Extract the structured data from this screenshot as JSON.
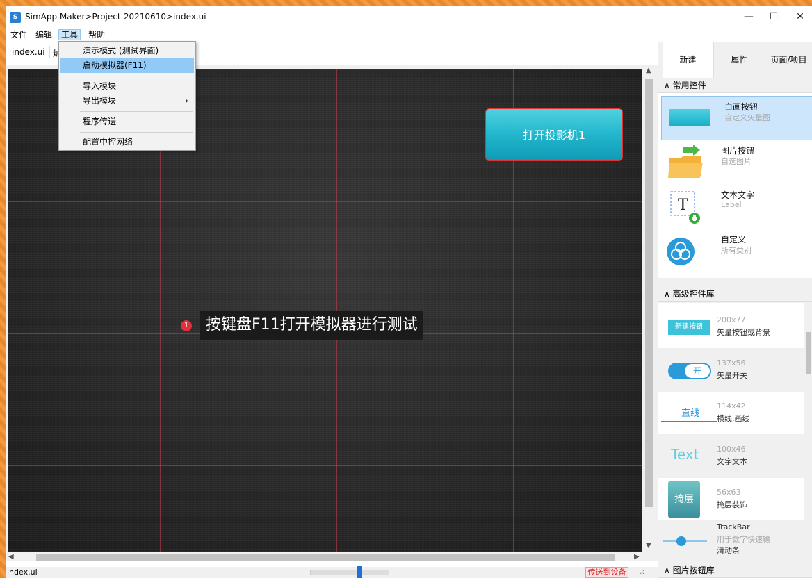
{
  "window": {
    "title": "SimApp Maker>Project-20210610>index.ui",
    "controls": {
      "minimize": "—",
      "maximize": "☐",
      "close": "✕"
    }
  },
  "menubar": [
    "文件",
    "编辑",
    "工具",
    "帮助"
  ],
  "tabs": {
    "doc": "index.ui",
    "doc2_partial": "炉"
  },
  "dropdown": {
    "items": [
      "演示模式 (测试界面)",
      "启动模拟器(F11)",
      "导入模块",
      "导出模块",
      "程序传送",
      "配置中控网络"
    ],
    "submenu_arrow": "›"
  },
  "canvas": {
    "button_label": "打开投影机1",
    "tip_number": "1",
    "tip_text": "按键盘F11打开模拟器进行测试"
  },
  "statusbar": {
    "file": "index.ui",
    "send_button": "传送到设备",
    "grip": ".:"
  },
  "rpanel": {
    "tabs": [
      "新建",
      "属性",
      "页面/项目"
    ],
    "common_header": "∧  常用控件",
    "common_items": [
      {
        "title": "自画按钮",
        "sub": "自定义矢量图"
      },
      {
        "title": "图片按钮",
        "sub": "自选图片"
      },
      {
        "title": "文本文字",
        "sub": "Label"
      },
      {
        "title": "自定义",
        "sub": "所有类别"
      }
    ],
    "adv_header": "∧  高级控件库",
    "adv_items": [
      {
        "thumb": "新建按钮",
        "size": "200x77",
        "desc": "矢量按钮或背景"
      },
      {
        "thumb": "开",
        "size": "137x56",
        "desc": "矢量开关"
      },
      {
        "thumb": "直线",
        "size": "114x42",
        "desc": "横线,画线"
      },
      {
        "thumb": "Text",
        "size": "100x46",
        "desc": "文字文本"
      },
      {
        "thumb": "掩层",
        "size": "56x63",
        "desc": "掩层装饰"
      },
      {
        "thumb": "",
        "size": "TrackBar",
        "desc": "用于数字快速输",
        "desc2": "滑动条"
      }
    ],
    "pic_header": "∧  图片按钮库"
  },
  "colors": {
    "accent": "#22b6cc",
    "highlight": "#91c9f7",
    "send_red": "#d02020"
  }
}
